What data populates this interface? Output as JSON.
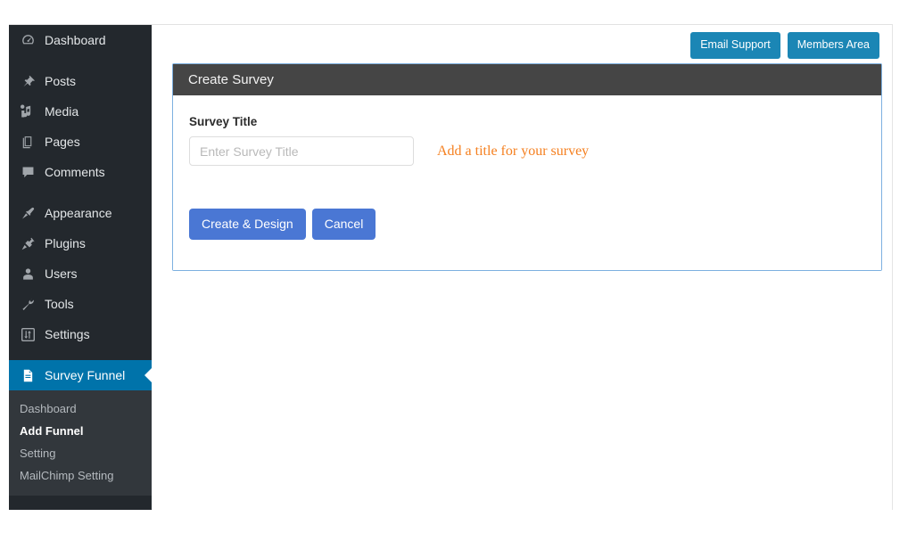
{
  "sidebar": {
    "primary_items": [
      {
        "label": "Dashboard",
        "icon": "dashboard-icon",
        "active": false
      },
      {
        "label": "Posts",
        "icon": "pin-icon",
        "active": false
      },
      {
        "label": "Media",
        "icon": "media-icon",
        "active": false
      },
      {
        "label": "Pages",
        "icon": "pages-icon",
        "active": false
      },
      {
        "label": "Comments",
        "icon": "comments-icon",
        "active": false
      },
      {
        "label": "Appearance",
        "icon": "paintbrush-icon",
        "active": false
      },
      {
        "label": "Plugins",
        "icon": "plug-icon",
        "active": false
      },
      {
        "label": "Users",
        "icon": "user-icon",
        "active": false
      },
      {
        "label": "Tools",
        "icon": "wrench-icon",
        "active": false
      },
      {
        "label": "Settings",
        "icon": "settings-sliders-icon",
        "active": false
      },
      {
        "label": "Survey Funnel",
        "icon": "document-icon",
        "active": true
      }
    ],
    "submenu_items": [
      {
        "label": "Dashboard",
        "current": false
      },
      {
        "label": "Add Funnel",
        "current": true
      },
      {
        "label": "Setting",
        "current": false
      },
      {
        "label": "MailChimp Setting",
        "current": false
      }
    ]
  },
  "topbar": {
    "email_support_label": "Email Support",
    "members_area_label": "Members Area"
  },
  "panel": {
    "title": "Create Survey",
    "field_label": "Survey Title",
    "input_value": "",
    "input_placeholder": "Enter Survey Title",
    "help_text": "Add a title for your survey",
    "submit_label": "Create & Design",
    "cancel_label": "Cancel"
  },
  "colors": {
    "sidebar_bg": "#23282d",
    "submenu_bg": "#32373c",
    "active_blue": "#0073aa",
    "teal_button": "#1b86b5",
    "primary_button": "#4a77d4",
    "panel_header": "#454545",
    "panel_border": "#7db0e0",
    "help_orange": "#f58020"
  }
}
